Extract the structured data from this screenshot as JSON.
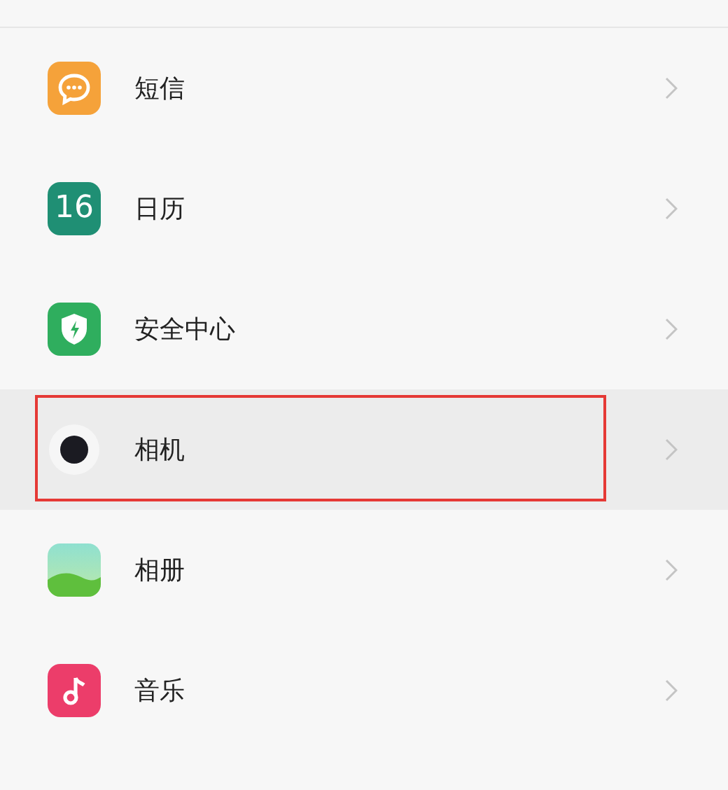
{
  "apps": [
    {
      "kind": "message",
      "label": "短信",
      "highlighted": false
    },
    {
      "kind": "calendar",
      "label": "日历",
      "icon_text": "16",
      "highlighted": false
    },
    {
      "kind": "security",
      "label": "安全中心",
      "highlighted": false
    },
    {
      "kind": "camera",
      "label": "相机",
      "highlighted": true
    },
    {
      "kind": "gallery",
      "label": "相册",
      "highlighted": false
    },
    {
      "kind": "music",
      "label": "音乐",
      "highlighted": false
    }
  ]
}
